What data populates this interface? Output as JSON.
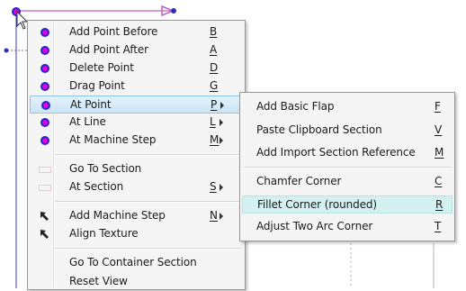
{
  "colors": {
    "point_outer": "#2828c8",
    "point_inner": "#e000e0",
    "highlight": "#cbe5f7",
    "highlight_sub": "#d4f1f1",
    "curve": "#c060c0"
  },
  "main_menu": {
    "items": [
      {
        "label": "Add Point Before",
        "key": "B",
        "icon": "point-icon"
      },
      {
        "label": "Add Point After",
        "key": "A",
        "icon": "point-icon"
      },
      {
        "label": "Delete Point",
        "key": "D",
        "icon": "point-icon"
      },
      {
        "label": "Drag Point",
        "key": "G",
        "icon": "point-icon"
      },
      {
        "label": "At Point",
        "key": "P",
        "icon": "point-icon",
        "submenu": true
      },
      {
        "label": "At Line",
        "key": "L",
        "icon": "point-icon",
        "submenu": true
      },
      {
        "label": "At Machine Step",
        "key": "M",
        "icon": "point-icon",
        "submenu": true
      },
      {
        "label": "Go To Section",
        "key": "",
        "icon": "section-icon"
      },
      {
        "label": "At Section",
        "key": "S",
        "icon": "section-icon",
        "submenu": true
      },
      {
        "label": "Add Machine Step",
        "key": "N",
        "icon": "arrow-icon",
        "submenu": true
      },
      {
        "label": "Align Texture",
        "key": "",
        "icon": "arrow-icon"
      },
      {
        "label": "Go To Container Section",
        "key": ""
      },
      {
        "label": "Reset View",
        "key": ""
      }
    ]
  },
  "submenu": {
    "items": [
      {
        "label": "Add Basic Flap",
        "key": "F"
      },
      {
        "label": "Paste Clipboard Section",
        "key": "V"
      },
      {
        "label": "Add Import Section Reference",
        "key": "M"
      },
      {
        "label": "Chamfer Corner",
        "key": "C"
      },
      {
        "label": "Fillet Corner (rounded)",
        "key": "R"
      },
      {
        "label": "Adjust Two Arc Corner",
        "key": "T"
      }
    ]
  }
}
